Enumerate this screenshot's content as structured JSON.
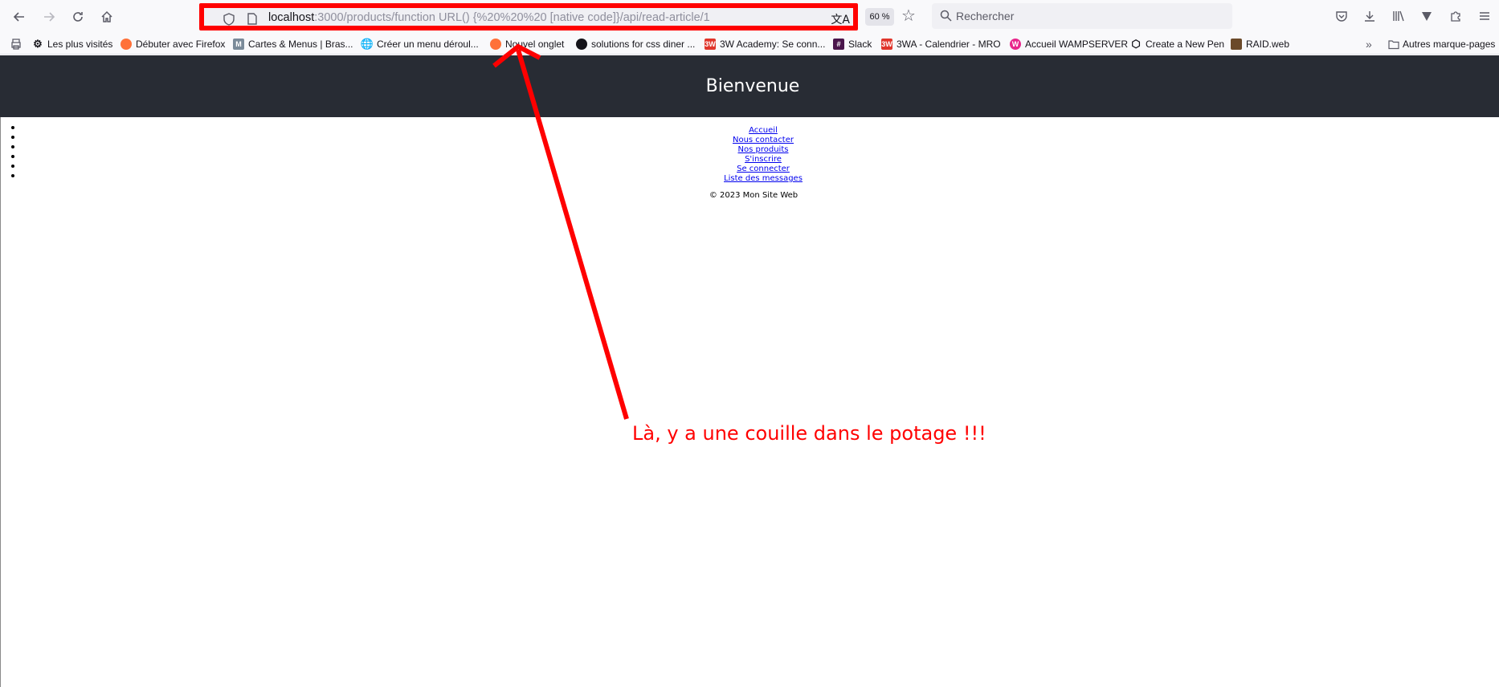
{
  "toolbar": {
    "back_icon": "arrow-left-icon",
    "forward_icon": "arrow-right-icon",
    "reload_icon": "reload-icon",
    "home_icon": "home-icon",
    "url_host": "localhost",
    "url_rest": ":3000/products/function URL() {%20%20%20 [native code]}/api/read-article/1",
    "zoom": "60 %",
    "search_placeholder": "Rechercher"
  },
  "bookmarks": [
    {
      "label": "Les plus visités",
      "icon": "gear-icon"
    },
    {
      "label": "Débuter avec Firefox",
      "icon": "firefox-icon"
    },
    {
      "label": "Cartes & Menus | Bras...",
      "icon": "bookmark-icon"
    },
    {
      "label": "Créer un menu déroul...",
      "icon": "globe-icon"
    },
    {
      "label": "Nouvel onglet",
      "icon": "firefox-icon"
    },
    {
      "label": "solutions for css diner ...",
      "icon": "github-icon"
    },
    {
      "label": "3W Academy: Se conn...",
      "icon": "3w-icon"
    },
    {
      "label": "Slack",
      "icon": "slack-icon"
    },
    {
      "label": "3WA - Calendrier - MRO",
      "icon": "3wa-icon"
    },
    {
      "label": "Accueil WAMPSERVER",
      "icon": "wamp-icon"
    },
    {
      "label": "Create a New Pen",
      "icon": "codepen-icon"
    },
    {
      "label": "RAID.web",
      "icon": "raid-icon"
    },
    {
      "label": "Autres marque-pages",
      "icon": "folder-icon"
    }
  ],
  "page": {
    "title": "Bienvenue",
    "nav": [
      "Accueil",
      "Nous contacter",
      "Nos produits",
      "S'inscrire",
      "Se connecter",
      "Liste des messages"
    ],
    "footer": "© 2023 Mon Site Web"
  },
  "annotation": {
    "text": "Là, y a une couille dans le potage !!!",
    "color": "#ff0000"
  },
  "colors": {
    "header_bg": "#282c34",
    "link": "#0000ee",
    "highlight": "#ff0000"
  }
}
